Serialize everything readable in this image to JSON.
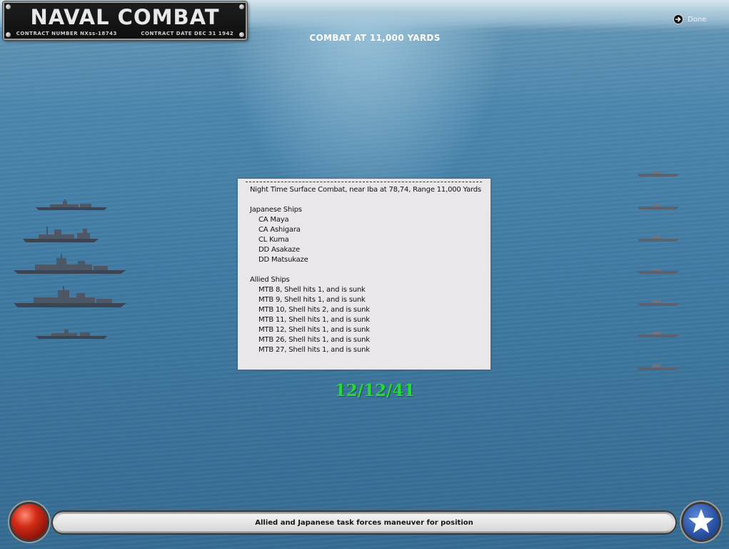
{
  "header": {
    "logo_title": "NAVAL COMBAT",
    "contract_number_label": "CONTRACT NUMBER",
    "contract_number": "NXss-18743",
    "contract_date_label": "CONTRACT DATE",
    "contract_date": "DEC 31 1942",
    "combat_title": "COMBAT AT 11,000 YARDS",
    "done_label": "Done"
  },
  "report": {
    "headline": "Night Time Surface Combat, near Iba at 78,74, Range 11,000 Yards",
    "japanese_header": "Japanese Ships",
    "japanese_ships": [
      "CA Maya",
      "CA Ashigara",
      "CL Kuma",
      "DD Asakaze",
      "DD Matsukaze"
    ],
    "allied_header": "Allied Ships",
    "allied_ships": [
      "MTB 8, Shell hits 1, and is sunk",
      "MTB 9, Shell hits 1, and is sunk",
      "MTB 10, Shell hits 2, and is sunk",
      "MTB 11, Shell hits 1, and is sunk",
      "MTB 12, Shell hits 1, and is sunk",
      "MTB 26, Shell hits 1, and is sunk",
      "MTB 27, Shell hits 1, and is sunk"
    ]
  },
  "date": "12/12/41",
  "status_message": "Allied and Japanese task forces maneuver for position",
  "colors": {
    "date_green": "#21dd31",
    "report_bg": "#e9e7ea",
    "sea_blue": "#3f7aa3"
  },
  "icons": {
    "done": "arrow-right-circle-icon",
    "left_button": "red-ball-button",
    "right_button": "white-star-icon"
  }
}
